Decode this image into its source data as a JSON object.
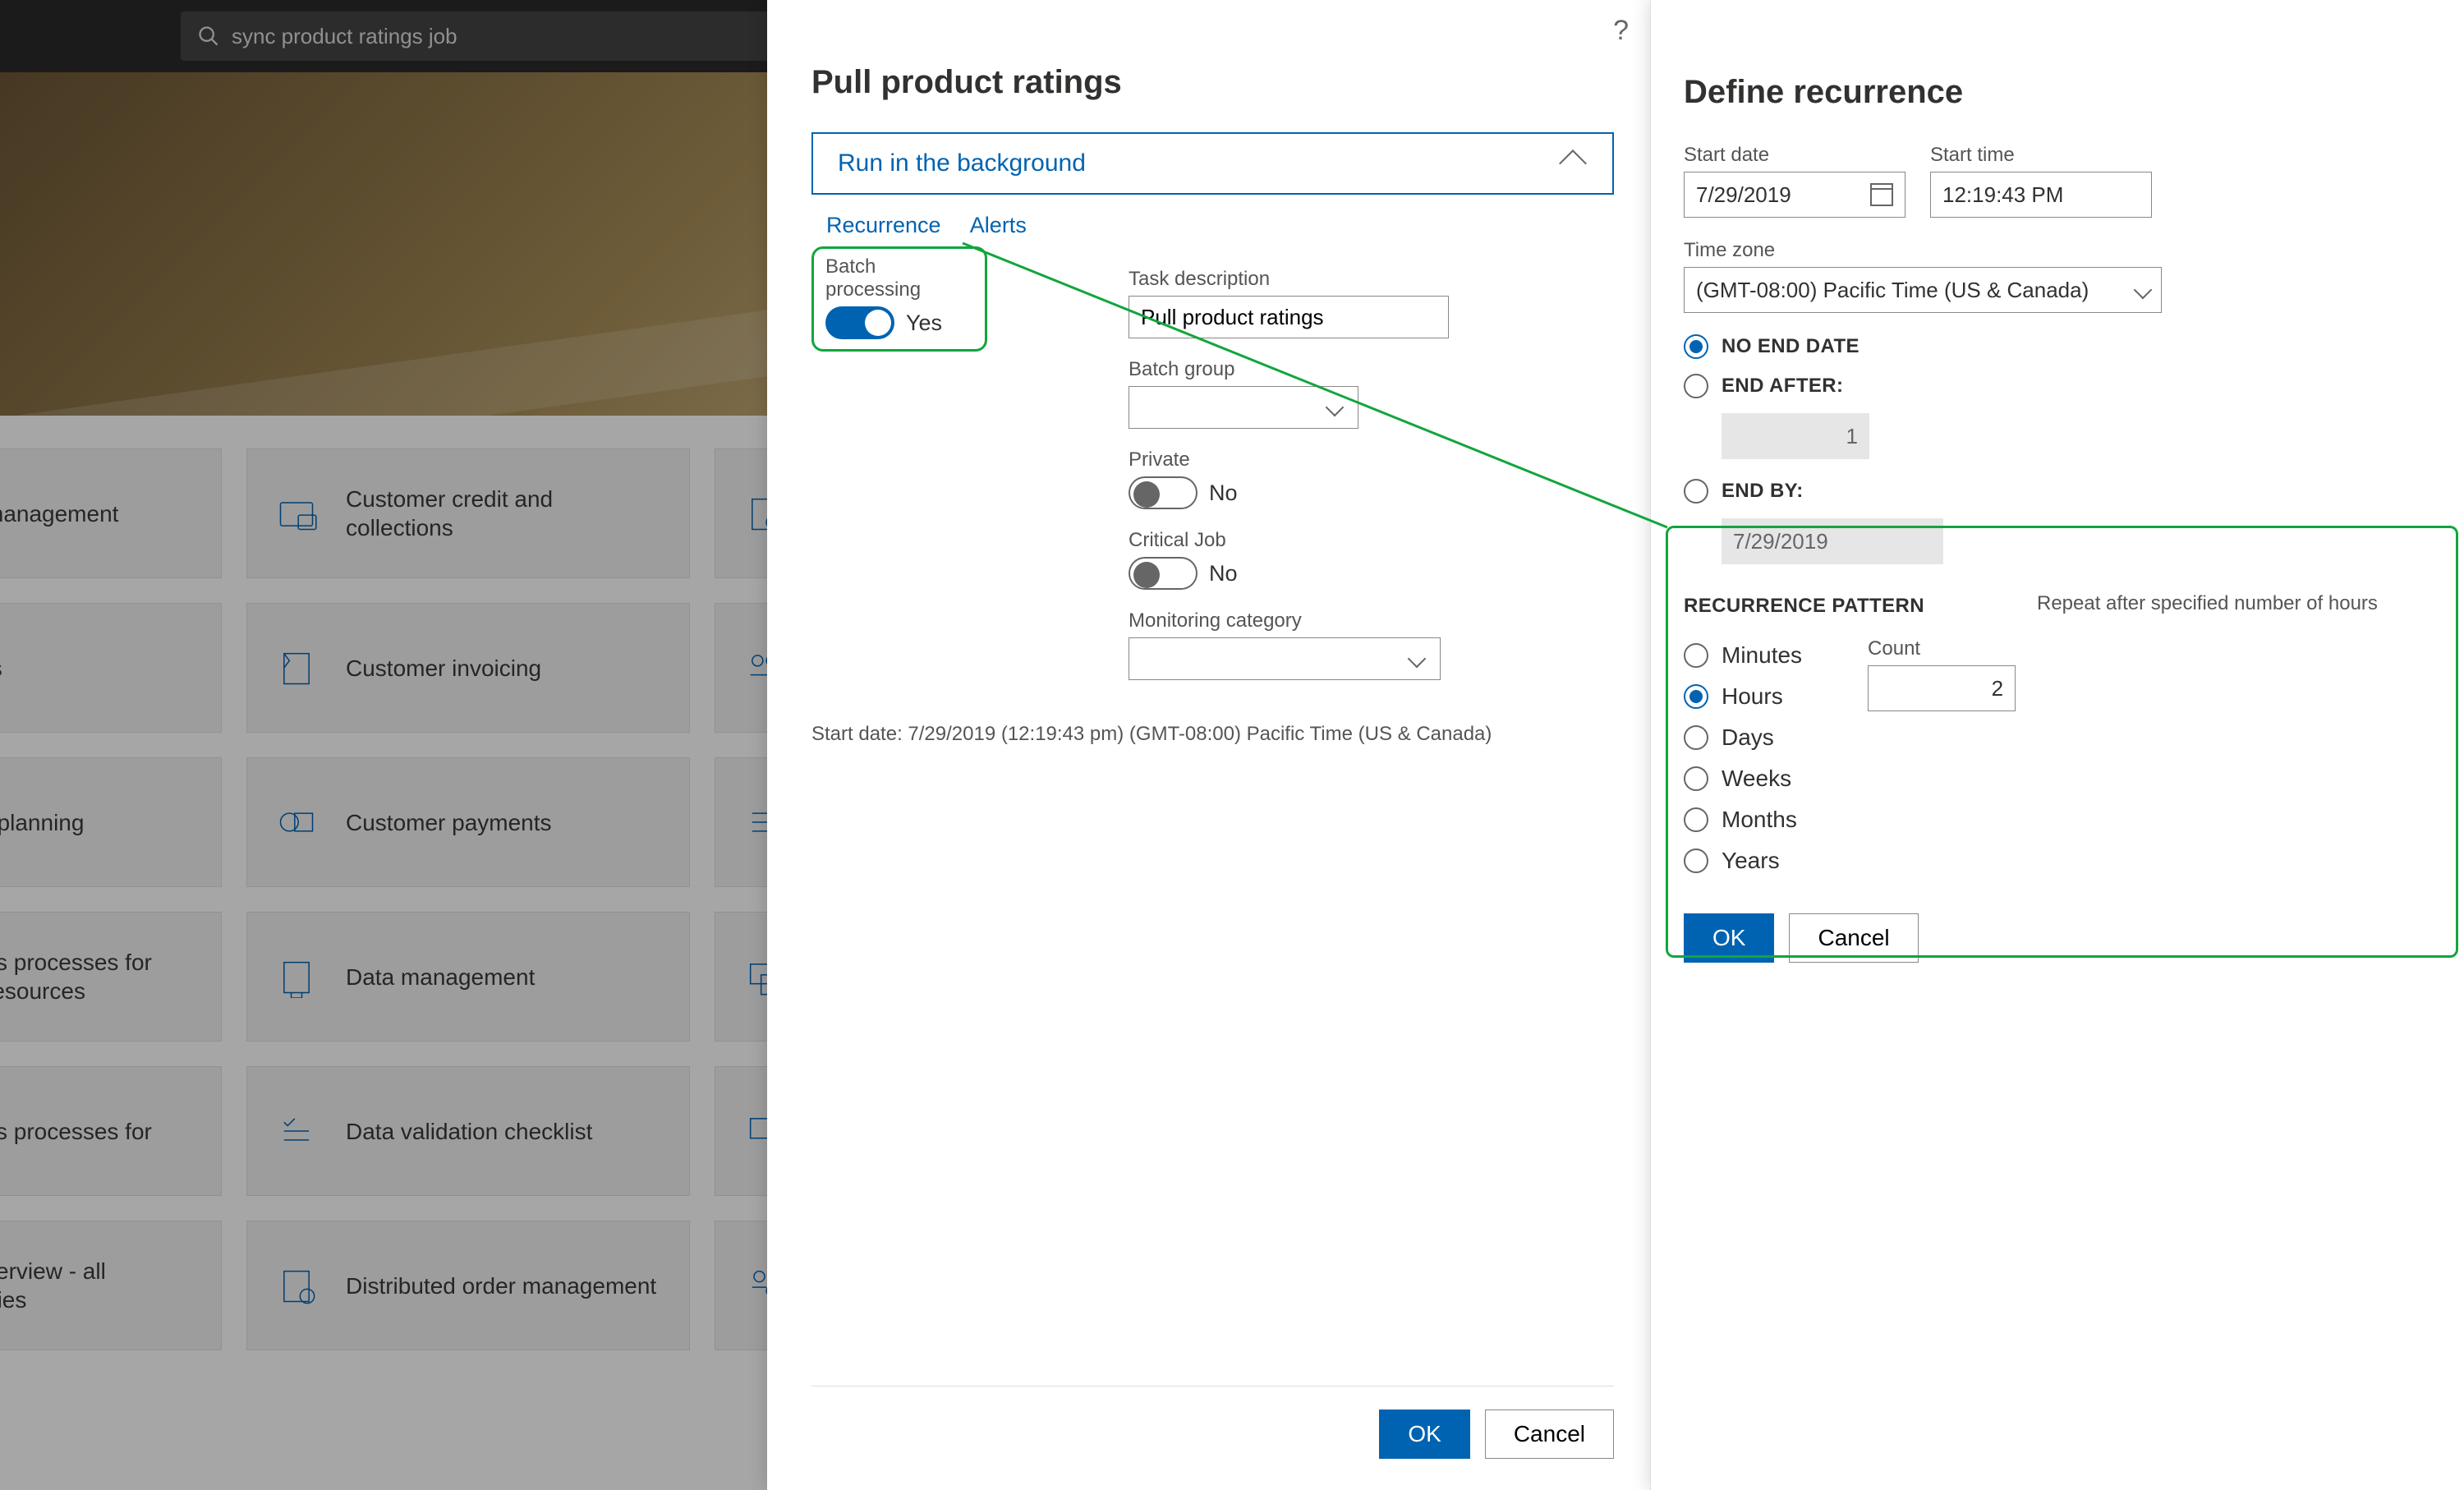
{
  "search": {
    "value": "sync product ratings job"
  },
  "tiles_col1": [
    "management",
    "ts",
    "t planning",
    "ss processes for\n resources",
    "ss processes for",
    "verview - all\nnies"
  ],
  "tiles_col2": [
    "Customer credit and collections",
    "Customer invoicing",
    "Customer payments",
    "Data management",
    "Data validation checklist",
    "Distributed order management"
  ],
  "mid": {
    "help": "?",
    "title": "Pull product ratings",
    "expander": "Run in the background",
    "tabs": {
      "recurrence": "Recurrence",
      "alerts": "Alerts"
    },
    "batch_label": "Batch processing",
    "batch_value": "Yes",
    "task_desc_label": "Task description",
    "task_desc_value": "Pull product ratings",
    "batch_group_label": "Batch group",
    "private_label": "Private",
    "private_value": "No",
    "critical_label": "Critical Job",
    "critical_value": "No",
    "monitoring_label": "Monitoring category",
    "start_info": "Start date: 7/29/2019 (12:19:43 pm) (GMT-08:00) Pacific Time (US & Canada)",
    "ok": "OK",
    "cancel": "Cancel"
  },
  "right": {
    "title": "Define recurrence",
    "start_date_label": "Start date",
    "start_date_value": "7/29/2019",
    "start_time_label": "Start time",
    "start_time_value": "12:19:43 PM",
    "timezone_label": "Time zone",
    "timezone_value": "(GMT-08:00) Pacific Time (US & Canada)",
    "end_none": "NO END DATE",
    "end_after": "END AFTER:",
    "end_after_value": "1",
    "end_by": "END BY:",
    "end_by_value": "7/29/2019",
    "pattern_title": "RECURRENCE PATTERN",
    "pattern_hint": "Repeat after specified number of hours",
    "units": [
      "Minutes",
      "Hours",
      "Days",
      "Weeks",
      "Months",
      "Years"
    ],
    "unit_selected": 1,
    "count_label": "Count",
    "count_value": "2",
    "ok": "OK",
    "cancel": "Cancel"
  }
}
